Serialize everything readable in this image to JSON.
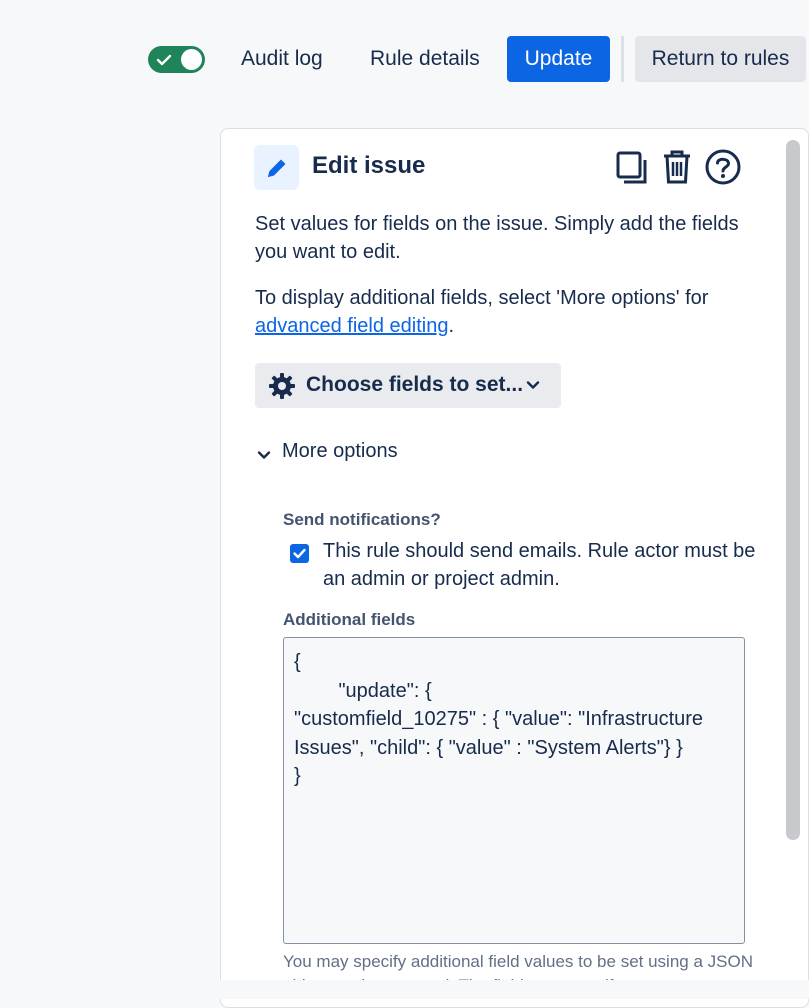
{
  "header": {
    "toggle_on": true,
    "audit_log": "Audit log",
    "rule_details": "Rule details",
    "update": "Update",
    "return_to_rules": "Return to rules"
  },
  "panel": {
    "title": "Edit issue",
    "icons": {
      "edit": "pencil-icon",
      "duplicate": "duplicate-icon",
      "delete": "trash-icon",
      "help": "help-icon"
    },
    "description": "Set values for fields on the issue. Simply add the fields you want to edit.",
    "additional_prefix": "To display additional fields, select 'More options' for ",
    "additional_link": "advanced field editing",
    "additional_suffix": ".",
    "choose_fields": "Choose fields to set...",
    "more_options": "More options",
    "send_notifications_label": "Send notifications?",
    "send_notifications_checked": true,
    "send_notifications_text": "This rule should send emails. Rule actor must be an admin or project admin.",
    "additional_fields_label": "Additional fields",
    "additional_fields_value": "{\n        \"update\": {\n\"customfield_10275\" : { \"value\": \"Infrastructure Issues\", \"child\": { \"value\" : \"System Alerts\"} }\n}",
    "help_text": "You may specify additional field values to be set using a JSON object as documented. The fields you specify must"
  },
  "colors": {
    "accent": "#0c66e4",
    "toggle": "#1f845a",
    "text": "#172b4d"
  }
}
